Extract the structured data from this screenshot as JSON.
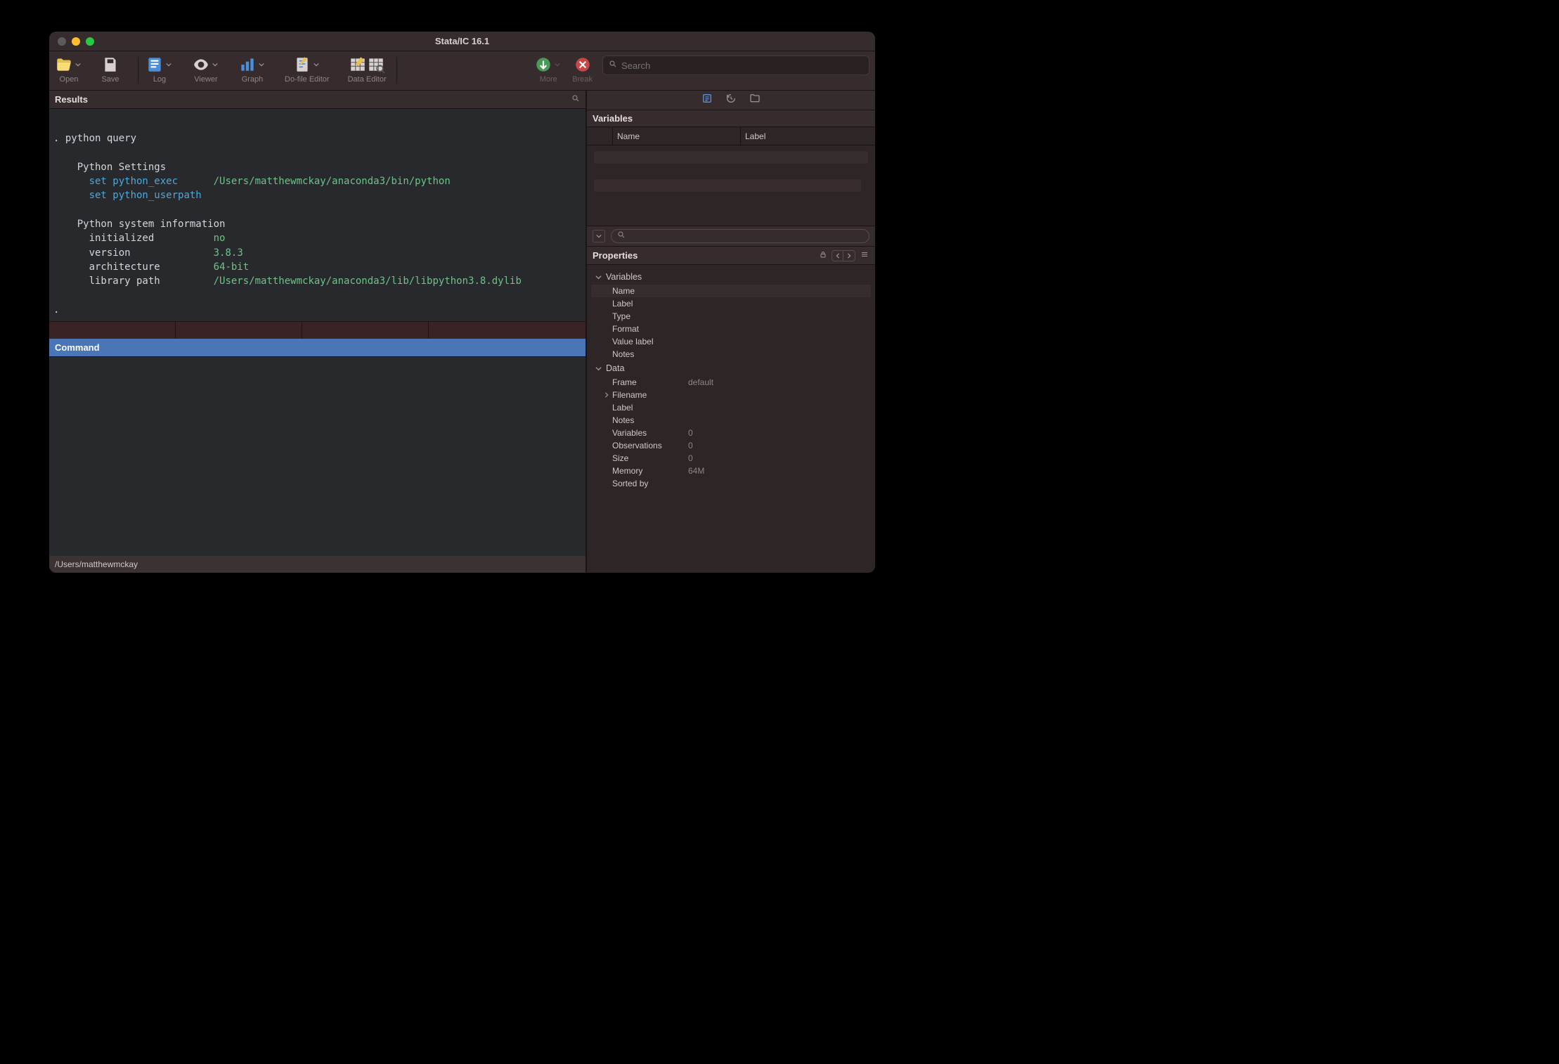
{
  "window_title": "Stata/IC 16.1",
  "toolbar": {
    "open": "Open",
    "save": "Save",
    "log": "Log",
    "viewer": "Viewer",
    "graph": "Graph",
    "dofile": "Do-file Editor",
    "dataeditor": "Data Editor",
    "more": "More",
    "break": "Break"
  },
  "search_placeholder": "Search",
  "results_title": "Results",
  "results": {
    "prompt": ". python query",
    "settings_title": "Python Settings",
    "set_exec_cmd": "set python_exec",
    "set_exec_val": "/Users/matthewmckay/anaconda3/bin/python",
    "set_userpath_cmd": "set python_userpath",
    "sysinfo_title": "Python system information",
    "initialized_k": "initialized",
    "initialized_v": "no",
    "version_k": "version",
    "version_v": "3.8.3",
    "arch_k": "architecture",
    "arch_v": "64-bit",
    "libpath_k": "library path",
    "libpath_v": "/Users/matthewmckay/anaconda3/lib/libpython3.8.dylib",
    "trailing_prompt": "."
  },
  "command_title": "Command",
  "status_path": "/Users/matthewmckay",
  "variables_title": "Variables",
  "var_cols": {
    "name": "Name",
    "label": "Label"
  },
  "properties_title": "Properties",
  "props": {
    "variables_section": "Variables",
    "name": "Name",
    "label": "Label",
    "type": "Type",
    "format": "Format",
    "value_label": "Value label",
    "notes": "Notes",
    "data_section": "Data",
    "frame": "Frame",
    "frame_v": "default",
    "filename": "Filename",
    "d_label": "Label",
    "d_notes": "Notes",
    "vars": "Variables",
    "vars_v": "0",
    "obs": "Observations",
    "obs_v": "0",
    "size": "Size",
    "size_v": "0",
    "memory": "Memory",
    "memory_v": "64M",
    "sorted": "Sorted by"
  }
}
